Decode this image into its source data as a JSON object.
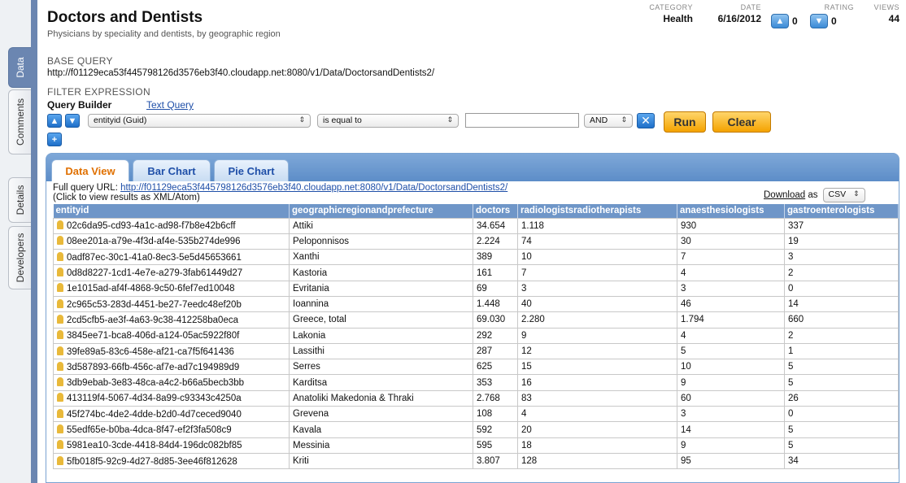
{
  "sidebar": {
    "tabs": [
      {
        "label": "Data",
        "active": true
      },
      {
        "label": "Comments",
        "active": false
      },
      {
        "label": "Details",
        "active": false
      },
      {
        "label": "Developers",
        "active": false
      }
    ]
  },
  "header": {
    "title": "Doctors and Dentists",
    "subtitle": "Physicians by speciality and dentists, by geographic region",
    "category_label": "CATEGORY",
    "category": "Health",
    "date_label": "DATE",
    "date": "6/16/2012",
    "rating_label": "RATING",
    "rating_up": "0",
    "rating_down": "0",
    "views_label": "VIEWS",
    "views": "44"
  },
  "query": {
    "base_label": "BASE QUERY",
    "base_url": "http://f01129eca53f445798126d3576eb3f40.cloudapp.net:8080/v1/Data/DoctorsandDentists2/",
    "filter_label": "FILTER EXPRESSION",
    "builder_label": "Query Builder",
    "text_query_label": "Text Query",
    "field_select": "entityid (Guid)",
    "operator_select": "is equal to",
    "filter_value": "",
    "logic_select": "AND",
    "run_label": "Run",
    "clear_label": "Clear"
  },
  "panel": {
    "tabs": [
      "Data View",
      "Bar Chart",
      "Pie Chart"
    ],
    "full_query_prefix": "Full query URL: ",
    "full_query_url": "http://f01129eca53f445798126d3576eb3f40.cloudapp.net:8080/v1/Data/DoctorsandDentists2/",
    "click_note": "(Click to view results as XML/Atom)",
    "download_label": "Download",
    "download_as": "as",
    "download_format": "CSV"
  },
  "table": {
    "columns": [
      "entityid",
      "geographicregionandprefecture",
      "doctors",
      "radiologistsradiotherapists",
      "anaesthesiologists",
      "gastroenterologists"
    ],
    "rows": [
      [
        "02c6da95-cd93-4a1c-ad98-f7b8e42b6cff",
        "Attiki",
        "34.654",
        "1.118",
        "930",
        "337"
      ],
      [
        "08ee201a-a79e-4f3d-af4e-535b274de996",
        "Peloponnisos",
        "2.224",
        "74",
        "30",
        "19"
      ],
      [
        "0adf87ec-30c1-41a0-8ec3-5e5d45653661",
        "Xanthi",
        "389",
        "10",
        "7",
        "3"
      ],
      [
        "0d8d8227-1cd1-4e7e-a279-3fab61449d27",
        "Kastoria",
        "161",
        "7",
        "4",
        "2"
      ],
      [
        "1e1015ad-af4f-4868-9c50-6fef7ed10048",
        "Evritania",
        "69",
        "3",
        "3",
        "0"
      ],
      [
        "2c965c53-283d-4451-be27-7eedc48ef20b",
        "Ioannina",
        "1.448",
        "40",
        "46",
        "14"
      ],
      [
        "2cd5cfb5-ae3f-4a63-9c38-412258ba0eca",
        "Greece, total",
        "69.030",
        "2.280",
        "1.794",
        "660"
      ],
      [
        "3845ee71-bca8-406d-a124-05ac5922f80f",
        "Lakonia",
        "292",
        "9",
        "4",
        "2"
      ],
      [
        "39fe89a5-83c6-458e-af21-ca7f5f641436",
        "Lassithi",
        "287",
        "12",
        "5",
        "1"
      ],
      [
        "3d587893-66fb-456c-af7e-ad7c194989d9",
        "Serres",
        "625",
        "15",
        "10",
        "5"
      ],
      [
        "3db9ebab-3e83-48ca-a4c2-b66a5becb3bb",
        "Karditsa",
        "353",
        "16",
        "9",
        "5"
      ],
      [
        "413119f4-5067-4d34-8a99-c93343c4250a",
        "Anatoliki Makedonia & Thraki",
        "2.768",
        "83",
        "60",
        "26"
      ],
      [
        "45f274bc-4de2-4dde-b2d0-4d7ceced9040",
        "Grevena",
        "108",
        "4",
        "3",
        "0"
      ],
      [
        "55edf65e-b0ba-4dca-8f47-ef2f3fa508c9",
        "Kavala",
        "592",
        "20",
        "14",
        "5"
      ],
      [
        "5981ea10-3cde-4418-84d4-196dc082bf85",
        "Messinia",
        "595",
        "18",
        "9",
        "5"
      ],
      [
        "5fb018f5-92c9-4d27-8d85-3ee46f812628",
        "Kriti",
        "3.807",
        "128",
        "95",
        "34"
      ]
    ]
  }
}
